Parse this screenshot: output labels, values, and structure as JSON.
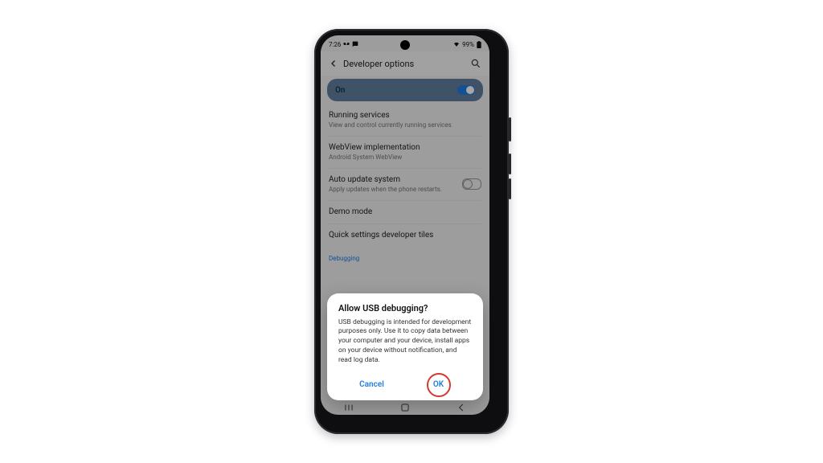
{
  "status": {
    "time": "7:26",
    "battery": "99%"
  },
  "header": {
    "title": "Developer options"
  },
  "master_switch": {
    "label": "On"
  },
  "settings": [
    {
      "title": "Running services",
      "subtitle": "View and control currently running services"
    },
    {
      "title": "WebView implementation",
      "subtitle": "Android System WebView"
    },
    {
      "title": "Auto update system",
      "subtitle": "Apply updates when the phone restarts.",
      "toggle": false
    },
    {
      "title": "Demo mode"
    },
    {
      "title": "Quick settings developer tiles"
    }
  ],
  "section_header": "Debugging",
  "dialog": {
    "title": "Allow USB debugging?",
    "message": "USB debugging is intended for development purposes only. Use it to copy data between your computer and your device, install apps on your device without notification, and read log data.",
    "cancel": "Cancel",
    "ok": "OK"
  }
}
